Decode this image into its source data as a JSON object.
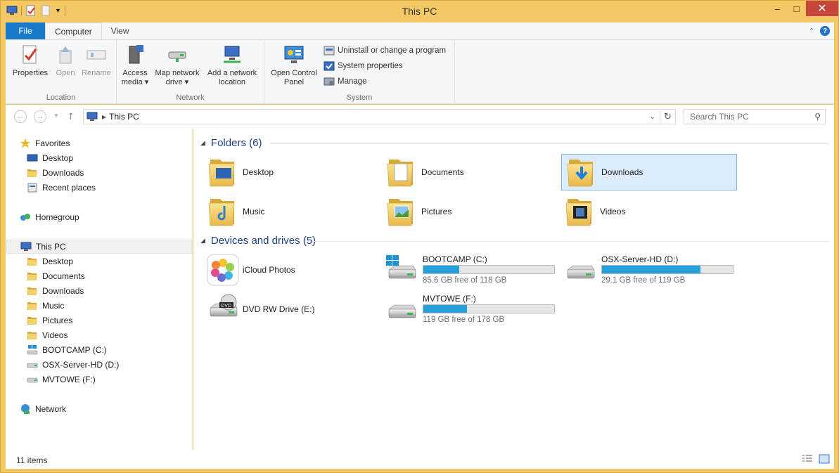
{
  "window": {
    "title": "This PC"
  },
  "tabs": {
    "file": "File",
    "computer": "Computer",
    "view": "View"
  },
  "ribbon": {
    "location": {
      "label": "Location",
      "properties": "Properties",
      "open": "Open",
      "rename": "Rename"
    },
    "network": {
      "label": "Network",
      "access_media_1": "Access",
      "access_media_2": "media ▾",
      "map_drive_1": "Map network",
      "map_drive_2": "drive ▾",
      "add_location_1": "Add a network",
      "add_location_2": "location"
    },
    "system": {
      "label": "System",
      "control_panel_1": "Open Control",
      "control_panel_2": "Panel",
      "uninstall": "Uninstall or change a program",
      "system_properties": "System properties",
      "manage": "Manage"
    }
  },
  "address": {
    "path": "This PC",
    "search_placeholder": "Search This PC"
  },
  "sidebar": {
    "favorites": "Favorites",
    "desktop": "Desktop",
    "downloads": "Downloads",
    "recent": "Recent places",
    "homegroup": "Homegroup",
    "this_pc": "This PC",
    "pc_desktop": "Desktop",
    "pc_documents": "Documents",
    "pc_downloads": "Downloads",
    "pc_music": "Music",
    "pc_pictures": "Pictures",
    "pc_videos": "Videos",
    "bootcamp": "BOOTCAMP (C:)",
    "osx": "OSX-Server-HD (D:)",
    "mvtowe": "MVTOWE (F:)",
    "network": "Network"
  },
  "folders": {
    "header": "Folders (6)",
    "desktop": "Desktop",
    "documents": "Documents",
    "downloads": "Downloads",
    "music": "Music",
    "pictures": "Pictures",
    "videos": "Videos"
  },
  "devices": {
    "header": "Devices and drives (5)",
    "icloud": "iCloud Photos",
    "dvd": "DVD RW Drive (E:)",
    "bootcamp": {
      "name": "BOOTCAMP (C:)",
      "free": "85.6 GB free of 118 GB",
      "used_fraction": 0.275
    },
    "osx": {
      "name": "OSX-Server-HD (D:)",
      "free": "29.1 GB free of 119 GB",
      "used_fraction": 0.755
    },
    "mvtowe": {
      "name": "MVTOWE (F:)",
      "free": "119 GB free of 178 GB",
      "used_fraction": 0.331
    }
  },
  "status": {
    "items": "11 items"
  },
  "colors": {
    "accent": "#1979ca",
    "drive_bar": "#26a0da",
    "header_blue": "#1e3f87"
  }
}
